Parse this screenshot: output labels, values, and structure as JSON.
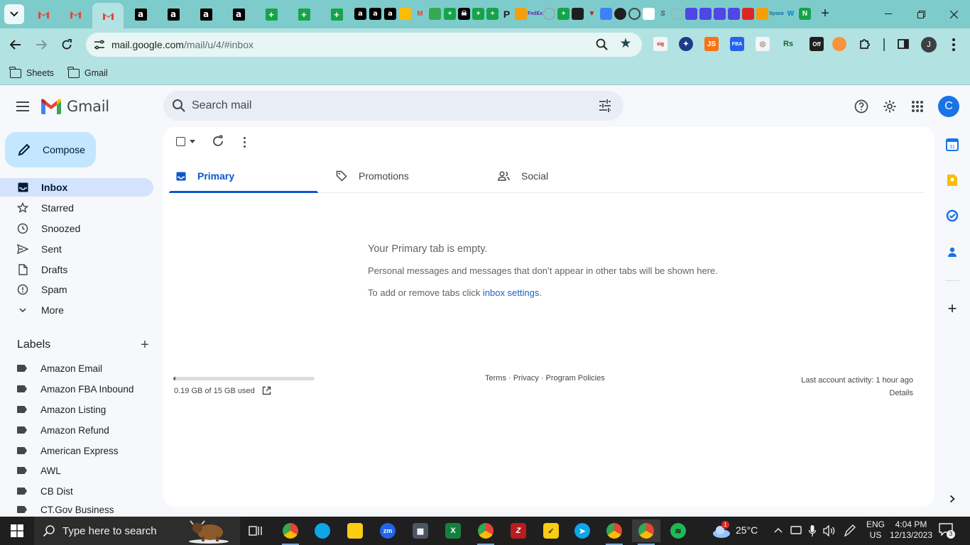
{
  "browser": {
    "url_host": "mail.google.com",
    "url_path": "/mail/u/4/#inbox",
    "bookmarks": [
      {
        "label": "Sheets"
      },
      {
        "label": "Gmail"
      }
    ]
  },
  "gmail": {
    "logo_text": "Gmail",
    "search_placeholder": "Search mail",
    "account_initial": "C",
    "compose_label": "Compose",
    "nav": [
      {
        "label": "Inbox",
        "icon": "inbox-icon",
        "active": true
      },
      {
        "label": "Starred",
        "icon": "star-icon"
      },
      {
        "label": "Snoozed",
        "icon": "clock-icon"
      },
      {
        "label": "Sent",
        "icon": "send-icon"
      },
      {
        "label": "Drafts",
        "icon": "draft-icon"
      },
      {
        "label": "Spam",
        "icon": "spam-icon"
      },
      {
        "label": "More",
        "icon": "chevron-down-icon"
      }
    ],
    "labels_title": "Labels",
    "labels": [
      "Amazon Email",
      "Amazon FBA Inbound",
      "Amazon Listing",
      "Amazon Refund",
      "American Express",
      "AWL",
      "CB Dist",
      "CT.Gov Business"
    ],
    "tabs": [
      {
        "label": "Primary",
        "icon": "inbox-tab-icon",
        "active": true
      },
      {
        "label": "Promotions",
        "icon": "tag-icon"
      },
      {
        "label": "Social",
        "icon": "people-icon"
      }
    ],
    "empty_title": "Your Primary tab is empty.",
    "empty_desc": "Personal messages and messages that don’t appear in other tabs will be shown here.",
    "empty_hint_prefix": "To add or remove tabs click ",
    "empty_hint_link": "inbox settings",
    "empty_hint_suffix": ".",
    "storage_text": "0.19 GB of 15 GB used",
    "storage_fraction": 0.013,
    "footer_links": "Terms · Privacy · Program Policies",
    "last_activity": "Last account activity: 1 hour ago",
    "details_link": "Details"
  },
  "taskbar": {
    "search_text": "Type here to search",
    "weather": "25°C",
    "weather_badge": "1",
    "lang_top": "ENG",
    "lang_bottom": "US",
    "time": "4:04 PM",
    "date": "12/13/2023",
    "notifications": "3"
  },
  "colors": {
    "chrome_frame": "#7ecbcb",
    "chrome_toolbar": "#b3e2e2",
    "gmail_accent": "#0b57d0",
    "compose_bg": "#c2e7ff",
    "active_nav_bg": "#d3e3fd"
  }
}
